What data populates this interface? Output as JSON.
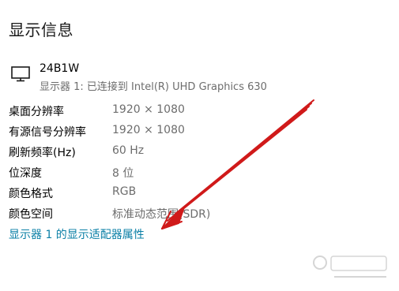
{
  "page": {
    "title": "显示信息"
  },
  "monitor": {
    "name": "24B1W",
    "connection": "显示器 1: 已连接到 Intel(R) UHD Graphics 630",
    "icon": "monitor-icon"
  },
  "info_rows": [
    {
      "label": "桌面分辨率",
      "value": "1920 × 1080"
    },
    {
      "label": "有源信号分辨率",
      "value": "1920 × 1080"
    },
    {
      "label": "刷新频率(Hz)",
      "value": "60 Hz"
    },
    {
      "label": "位深度",
      "value": "8 位"
    },
    {
      "label": "颜色格式",
      "value": "RGB"
    },
    {
      "label": "颜色空间",
      "value": "标准动态范围(SDR)"
    }
  ],
  "adapter_link": {
    "label": "显示器 1 的显示适配器属性"
  },
  "colors": {
    "link": "#0a7fa6",
    "secondary_text": "#6d6d6d",
    "annotation_arrow": "#d01a1a"
  }
}
